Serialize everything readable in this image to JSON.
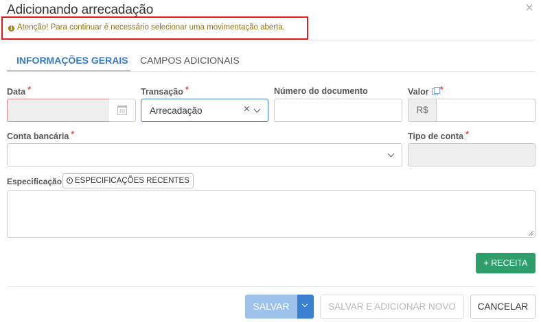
{
  "dialog": {
    "title": "Adicionando arrecadação",
    "close_symbol": "×"
  },
  "alert": {
    "icon": "info-circle-icon",
    "icon_glyph": "i",
    "text": "Atenção! Para continuar é necessário selecionar uma movimentação aberta."
  },
  "tabs": [
    {
      "label": "INFORMAÇÕES GERAIS",
      "active": true
    },
    {
      "label": "CAMPOS ADICIONAIS",
      "active": false
    }
  ],
  "form": {
    "required_mark": "*",
    "data": {
      "label": "Data",
      "value": ""
    },
    "transacao": {
      "label": "Transação",
      "value": "Arrecadação",
      "clear_symbol": "×"
    },
    "numero_documento": {
      "label": "Número do documento",
      "value": ""
    },
    "valor": {
      "label": "Valor",
      "prefix": "R$",
      "value": ""
    },
    "conta_bancaria": {
      "label": "Conta bancária",
      "value": ""
    },
    "tipo_conta": {
      "label": "Tipo de conta",
      "value": ""
    },
    "especificacao": {
      "label": "Especificação",
      "recent_button": "ESPECIFICAÇÕES RECENTES",
      "value": ""
    }
  },
  "buttons": {
    "receita": "+ RECEITA",
    "salvar": "SALVAR",
    "salvar_novo": "SALVAR E ADICIONAR NOVO",
    "cancelar": "CANCELAR"
  },
  "colors": {
    "primary": "#3579c8",
    "success": "#2e9e6a",
    "required": "#d9534f",
    "alert_border": "#e01b1b",
    "alert_text": "#8f7212"
  }
}
